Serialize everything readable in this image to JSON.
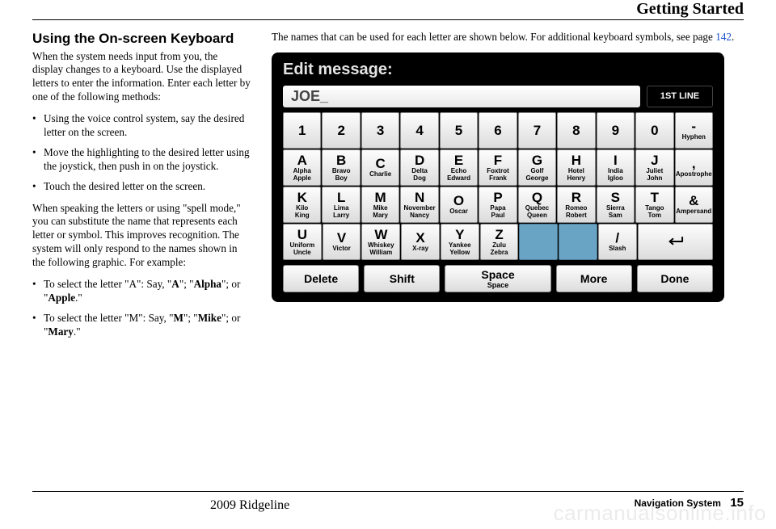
{
  "chapter": "Getting Started",
  "left": {
    "heading": "Using the On-screen Keyboard",
    "p1": "When the system needs input from you, the display changes to a keyboard. Use the displayed letters to enter the information. Enter each letter by one of the following methods:",
    "bullets_top": [
      "Using the voice control system, say the desired letter on the screen.",
      "Move the highlighting to the desired letter using the joystick, then push in on the joystick.",
      "Touch the desired letter on the screen."
    ],
    "p2": "When speaking the letters or using \"spell mode,\" you can substitute the name that represents each letter or symbol. This improves recognition. The system will only respond to the names shown in the following graphic. For example:",
    "bullets_bottom": [
      {
        "pre": "To select the letter \"A\": Say, \"",
        "b1": "A",
        "mid1": "\"; \"",
        "b2": "Alpha",
        "mid2": "\"; or \"",
        "b3": "Apple",
        "post": ".\""
      },
      {
        "pre": "To select the letter \"M\": Say, \"",
        "b1": "M",
        "mid1": "\"; \"",
        "b2": "Mike",
        "mid2": "\"; or \"",
        "b3": "Mary",
        "post": ".\""
      }
    ]
  },
  "right": {
    "intro_pre": "The names that can be used for each letter are shown below. For additional keyboard symbols, see page ",
    "intro_link": "142",
    "intro_post": ".",
    "kb_title": "Edit message:",
    "display": "JOE_",
    "firstline": "1ST LINE",
    "row0": [
      "1",
      "2",
      "3",
      "4",
      "5",
      "6",
      "7",
      "8",
      "9",
      "0"
    ],
    "row0_extra": {
      "big": "-",
      "sub": "Hyphen"
    },
    "row1": [
      {
        "big": "A",
        "sub": "Alpha\nApple"
      },
      {
        "big": "B",
        "sub": "Bravo\nBoy"
      },
      {
        "big": "C",
        "sub": "Charlie"
      },
      {
        "big": "D",
        "sub": "Delta\nDog"
      },
      {
        "big": "E",
        "sub": "Echo\nEdward"
      },
      {
        "big": "F",
        "sub": "Foxtrot\nFrank"
      },
      {
        "big": "G",
        "sub": "Golf\nGeorge"
      },
      {
        "big": "H",
        "sub": "Hotel\nHenry"
      },
      {
        "big": "I",
        "sub": "India\nIgloo"
      },
      {
        "big": "J",
        "sub": "Juliet\nJohn"
      },
      {
        "big": ",",
        "sub": "Apostrophe"
      }
    ],
    "row2": [
      {
        "big": "K",
        "sub": "Kilo\nKing"
      },
      {
        "big": "L",
        "sub": "Lima\nLarry"
      },
      {
        "big": "M",
        "sub": "Mike\nMary"
      },
      {
        "big": "N",
        "sub": "November\nNancy"
      },
      {
        "big": "O",
        "sub": "Oscar"
      },
      {
        "big": "P",
        "sub": "Papa\nPaul"
      },
      {
        "big": "Q",
        "sub": "Quebec\nQueen"
      },
      {
        "big": "R",
        "sub": "Romeo\nRobert"
      },
      {
        "big": "S",
        "sub": "Sierra\nSam"
      },
      {
        "big": "T",
        "sub": "Tango\nTom"
      },
      {
        "big": "&",
        "sub": "Ampersand"
      }
    ],
    "row3": [
      {
        "big": "U",
        "sub": "Uniform\nUncle"
      },
      {
        "big": "V",
        "sub": "Victor"
      },
      {
        "big": "W",
        "sub": "Whiskey\nWilliam"
      },
      {
        "big": "X",
        "sub": "X-ray"
      },
      {
        "big": "Y",
        "sub": "Yankee\nYellow"
      },
      {
        "big": "Z",
        "sub": "Zulu\nZebra"
      },
      {
        "big": "",
        "sub": "",
        "disabled": true
      },
      {
        "big": "",
        "sub": "",
        "disabled": true
      },
      {
        "big": "/",
        "sub": "Slash"
      },
      {
        "big": "ENTER",
        "enter": true
      }
    ],
    "bottom": [
      {
        "label": "Delete"
      },
      {
        "label": "Shift"
      },
      {
        "label": "Space",
        "sub": "Space"
      },
      {
        "label": "More"
      },
      {
        "label": "Done"
      }
    ]
  },
  "footer": {
    "vehicle": "2009  Ridgeline",
    "section": "Navigation System",
    "page": "15"
  },
  "watermark": "carmanualsonline.info"
}
